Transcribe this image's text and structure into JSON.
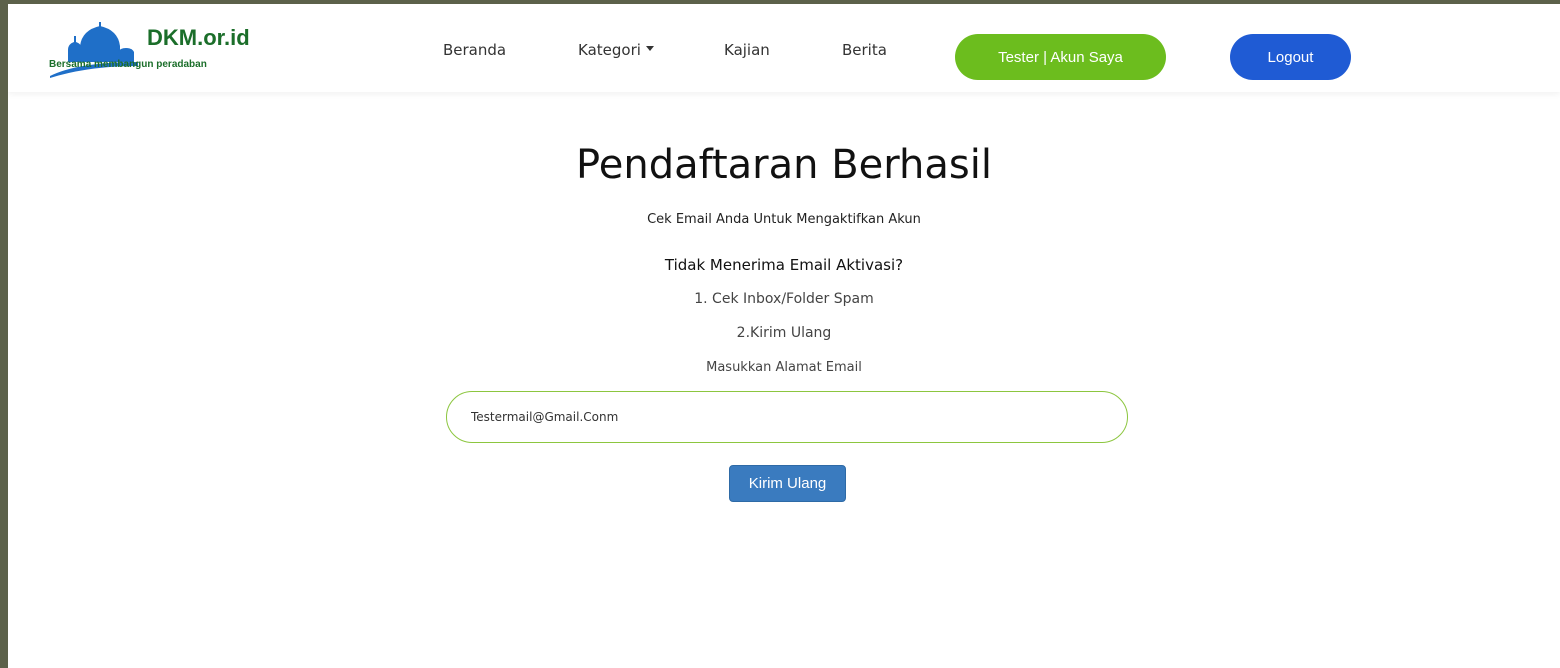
{
  "brand": {
    "name": "DKM.or.id",
    "tagline": "Bersama membangun peradaban",
    "colors": {
      "brand_green": "#1b6e2a",
      "logo_blue": "#1f6fc8"
    }
  },
  "nav": {
    "items": [
      {
        "label": "Beranda"
      },
      {
        "label": "Kategori",
        "icon": "caret-down-icon"
      },
      {
        "label": "Kajian"
      },
      {
        "label": "Berita"
      }
    ],
    "account_label": "Tester | Akun Saya",
    "logout_label": "Logout",
    "colors": {
      "account_button": "#6cbd1e",
      "logout_button": "#1f5bd4"
    }
  },
  "main": {
    "title": "Pendaftaran Berhasil",
    "subtitle": "Cek Email Anda Untuk Mengaktifkan Akun",
    "question": "Tidak Menerima Email Aktivasi?",
    "step1": "1. Cek Inbox/Folder Spam",
    "step2": "2.Kirim Ulang",
    "email_label": "Masukkan Alamat Email",
    "email_value": "Testermail@Gmail.Conm",
    "resend_label": "Kirim Ulang",
    "colors": {
      "input_border": "#8cc63f",
      "resend_button": "#3a7bbf"
    }
  }
}
